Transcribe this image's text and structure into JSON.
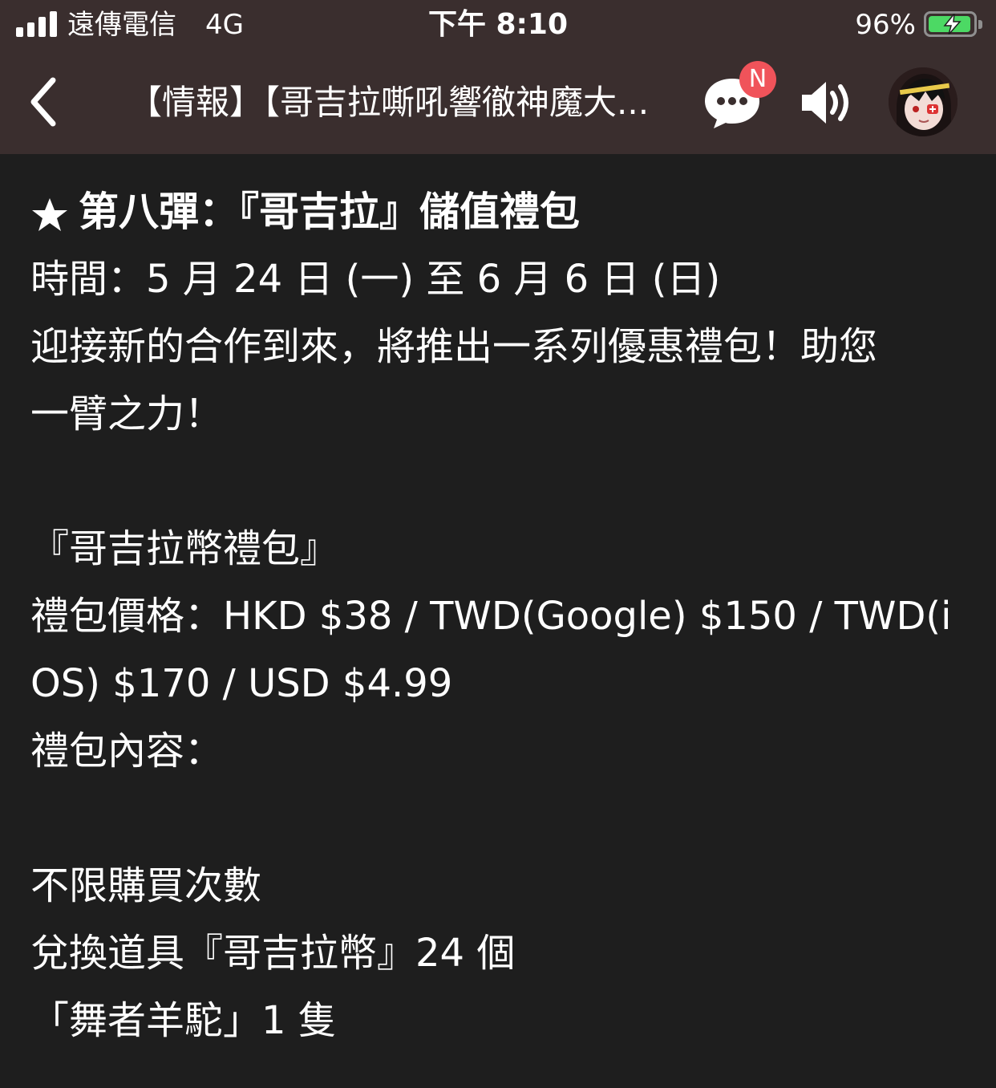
{
  "status_bar": {
    "carrier": "遠傳電信",
    "network": "4G",
    "time": "下午 8:10",
    "battery_percent": "96%",
    "battery_level": 0.96,
    "signal_bars": 4
  },
  "nav_bar": {
    "back_icon": "chevron-left-icon",
    "title": "【情報】【哥吉拉嘶吼響徹神魔大...",
    "chat_badge": "N",
    "chat_icon": "chat-bubble-icon",
    "speaker_icon": "speaker-icon"
  },
  "article": {
    "heading": "第八彈：『哥吉拉』儲值禮包",
    "time_line": "時間：5 月 24 日 (一) 至 6 月 6 日 (日)",
    "intro_line1": "迎接新的合作到來，將推出一系列優惠禮包！助您",
    "intro_line2": "一臂之力！",
    "pack_name": "『哥吉拉幣禮包』",
    "price_line1": "禮包價格：HKD $38 / TWD(Google) $150 / TWD(i",
    "price_line2": "OS) $170 / USD $4.99",
    "contents_label": "禮包內容：",
    "limit": "不限購買次數",
    "item1": "兌換道具『哥吉拉幣』24 個",
    "item2": "「舞者羊駝」1 隻"
  },
  "colors": {
    "header_bg": "#3a2e2e",
    "content_bg": "#1e1e1e",
    "text": "#ffffff",
    "badge": "#f0535a",
    "battery": "#4cd964"
  }
}
